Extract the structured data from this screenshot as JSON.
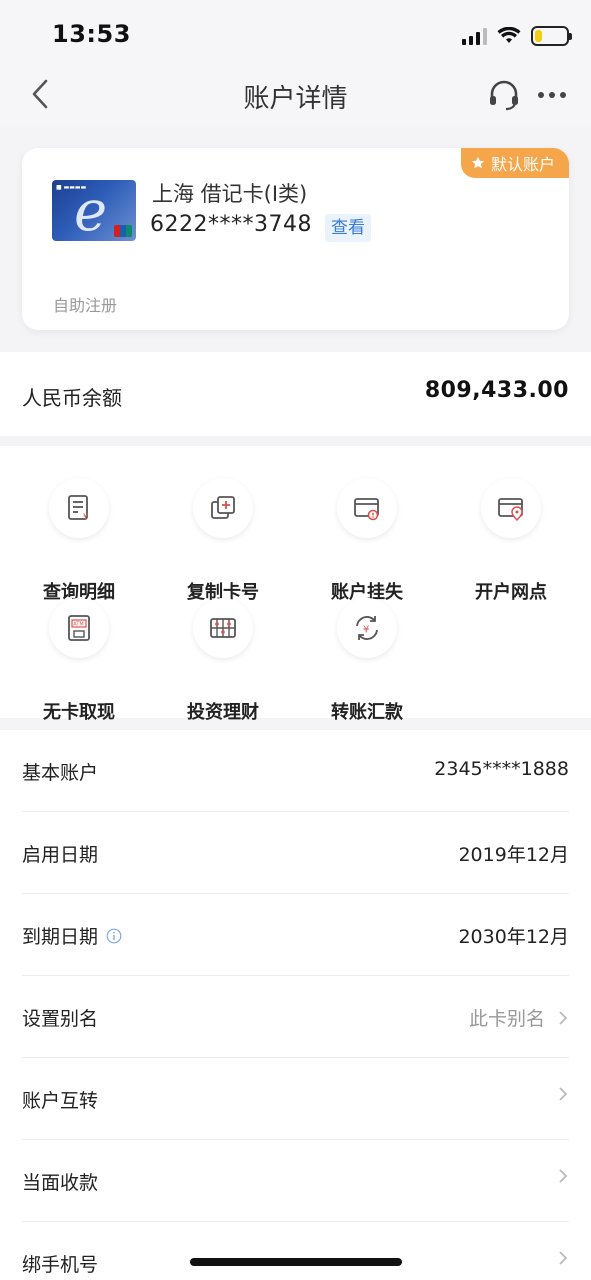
{
  "status": {
    "time": "13:53",
    "battery_level": 0.22,
    "battery_color": "#f5cc14"
  },
  "nav": {
    "title": "账户详情",
    "back_icon": "chevron-left-icon",
    "support_icon": "headset-icon",
    "more_icon": "more-icon"
  },
  "card": {
    "badge": "默认账户",
    "name": "上海 借记卡(I类)",
    "number": "6222****3748",
    "view_label": "查看",
    "note": "自助注册",
    "badge_color": "#f5a54a"
  },
  "balance": {
    "label": "人民币余额",
    "value": "809,433.00"
  },
  "actions": [
    {
      "label": "查询明细",
      "icon": "statement-icon"
    },
    {
      "label": "复制卡号",
      "icon": "copy-card-icon"
    },
    {
      "label": "账户挂失",
      "icon": "report-loss-icon"
    },
    {
      "label": "开户网点",
      "icon": "branch-location-icon"
    },
    {
      "label": "无卡取现",
      "icon": "atm-icon"
    },
    {
      "label": "投资理财",
      "icon": "invest-icon"
    },
    {
      "label": "转账汇款",
      "icon": "transfer-icon"
    }
  ],
  "info": [
    {
      "label": "基本账户",
      "value": "2345****1888"
    },
    {
      "label": "启用日期",
      "value": "2019年12月"
    },
    {
      "label": "到期日期",
      "value": "2030年12月",
      "has_info_icon": true
    },
    {
      "label": "设置别名",
      "value": "此卡别名",
      "arrow": true
    },
    {
      "label": "账户互转",
      "value": "",
      "arrow": true
    },
    {
      "label": "当面收款",
      "value": "",
      "arrow": true
    },
    {
      "label": "绑手机号",
      "value": "",
      "arrow": true
    }
  ],
  "colors": {
    "accent_red": "#d9534f",
    "link_blue": "#3a7bd5"
  }
}
